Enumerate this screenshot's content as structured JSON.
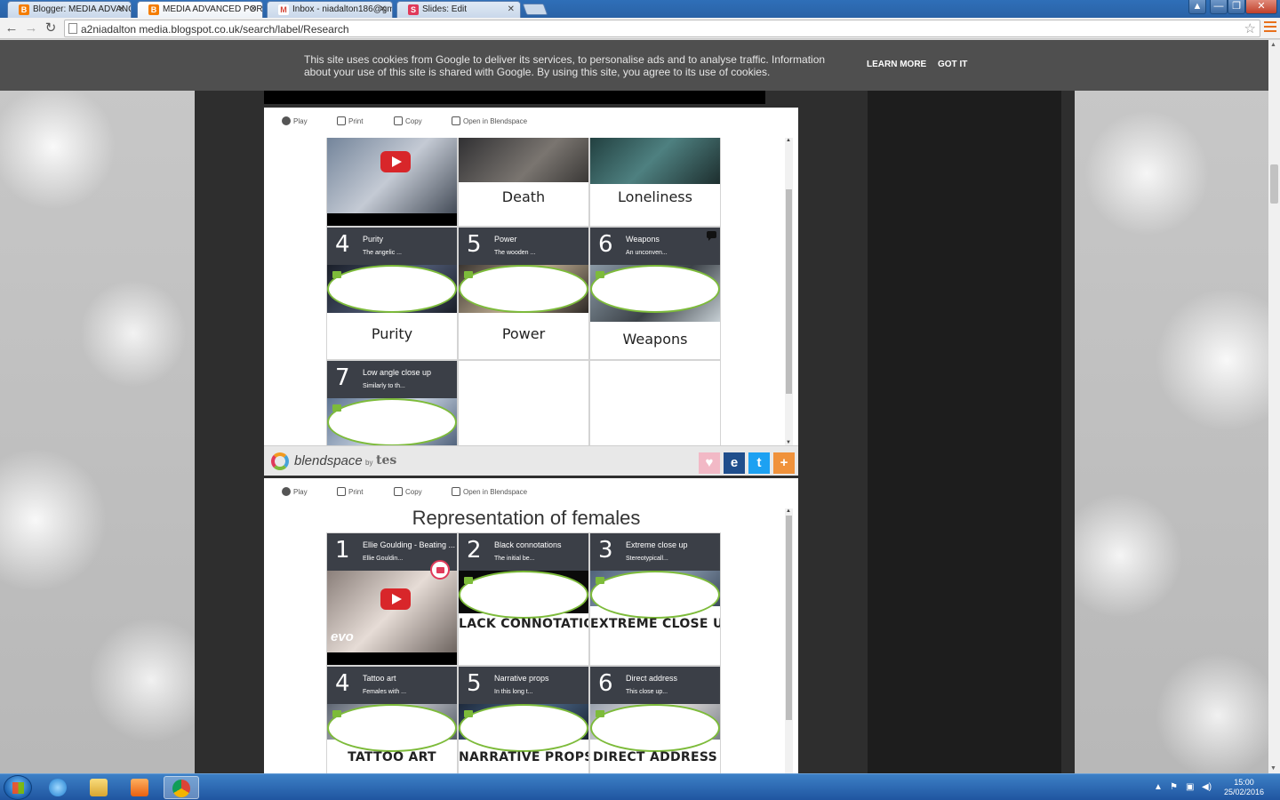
{
  "browser": {
    "tabs": [
      {
        "label": "Blogger: MEDIA ADVANCE",
        "icon": "blogger-icon",
        "color": "#f57d00",
        "active": false
      },
      {
        "label": "MEDIA ADVANCED PORTF",
        "icon": "blogger-icon",
        "color": "#f57d00",
        "active": true
      },
      {
        "label": "Inbox - niadalton186@gm",
        "icon": "gmail-icon",
        "color": "#d44638",
        "active": false
      },
      {
        "label": "Slides: Edit",
        "icon": "slides-icon",
        "color": "#e03a5a",
        "active": false
      }
    ],
    "url": "a2niadalton media.blogspot.co.uk/search/label/Research",
    "window_controls": {
      "minimize": "—",
      "maximize": "❐",
      "close": "✕"
    }
  },
  "cookie_banner": {
    "message": "This site uses cookies from Google to deliver its services, to personalise ads and to analyse traffic. Information about your use of this site is shared with Google. By using this site, you agree to its use of cookies.",
    "learn_more": "LEARN MORE",
    "got_it": "GOT IT"
  },
  "widget_toolbar": {
    "play": "Play",
    "print": "Print",
    "copy": "Copy",
    "open": "Open in Blendspace"
  },
  "widget1": {
    "top_row_captions": [
      "Death",
      "Loneliness"
    ],
    "tiles": [
      {
        "num": "4",
        "title": "Purity",
        "sub": "The angelic ...",
        "caption": "Purity"
      },
      {
        "num": "5",
        "title": "Power",
        "sub": "The wooden ...",
        "caption": "Power"
      },
      {
        "num": "6",
        "title": "Weapons",
        "sub": "An unconven...",
        "caption": "Weapons"
      },
      {
        "num": "7",
        "title": "Low angle close up",
        "sub": "Similarly to th...",
        "caption": ""
      }
    ]
  },
  "footer": {
    "brand": "blendspace",
    "by": "by",
    "tes": "tes"
  },
  "widget2": {
    "title": "Representation of females",
    "tiles": [
      {
        "num": "1",
        "title": "Ellie Goulding - Beating ...",
        "sub": "Ellie Gouldin...",
        "caption": ""
      },
      {
        "num": "2",
        "title": "Black connotations",
        "sub": "The initial be...",
        "caption": "LACK CONNOTATIO"
      },
      {
        "num": "3",
        "title": "Extreme close up",
        "sub": "Stereotypicall...",
        "caption": "EXTREME CLOSE UP"
      },
      {
        "num": "4",
        "title": "Tattoo art",
        "sub": "Females with ...",
        "caption": "TATTOO ART"
      },
      {
        "num": "5",
        "title": "Narrative props",
        "sub": "In this long t...",
        "caption": "NARRATIVE PROPS"
      },
      {
        "num": "6",
        "title": "Direct address",
        "sub": "This close up...",
        "caption": "DIRECT ADDRESS"
      }
    ],
    "vevo": "evo"
  },
  "taskbar": {
    "time": "15:00",
    "date": "25/02/2016"
  }
}
